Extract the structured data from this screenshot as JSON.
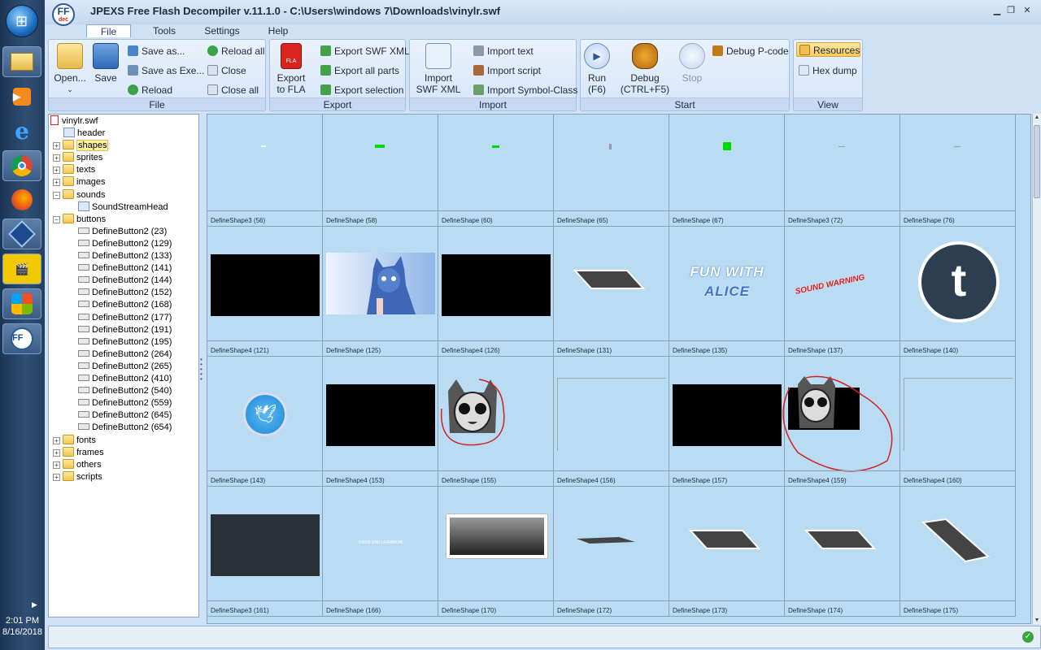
{
  "taskbar": {
    "icons": [
      "windows-start-icon",
      "file-explorer-icon",
      "media-player-icon",
      "internet-explorer-icon",
      "chrome-icon",
      "firefox-icon",
      "virtualbox-icon",
      "video-editor-icon",
      "windows-media-icon",
      "jpexs-ffdec-icon"
    ],
    "time": "2:01 PM",
    "date": "8/16/2018"
  },
  "window": {
    "title": "JPEXS Free Flash Decompiler v.11.1.0 - C:\\Users\\windows 7\\Downloads\\vinylr.swf",
    "logo_text": "FF",
    "logo_sub": "dec"
  },
  "ribbon": {
    "tabs": [
      "File",
      "Tools",
      "Settings",
      "Help"
    ],
    "active_tab": "File",
    "groups": {
      "file": {
        "label": "File",
        "open": "Open...",
        "save": "Save",
        "save_as": "Save as...",
        "save_as_exe": "Save as Exe...",
        "reload": "Reload",
        "reload_all": "Reload all",
        "close": "Close",
        "close_all": "Close all"
      },
      "export": {
        "label": "Export",
        "export_fla_1": "Export",
        "export_fla_2": "to FLA",
        "export_swf_xml": "Export SWF XML",
        "export_all_parts": "Export all parts",
        "export_selection": "Export selection"
      },
      "import": {
        "label": "Import",
        "import_swf_xml_1": "Import",
        "import_swf_xml_2": "SWF XML",
        "import_text": "Import text",
        "import_script": "Import script",
        "import_symbol_class": "Import Symbol-Class"
      },
      "start": {
        "label": "Start",
        "run_1": "Run",
        "run_2": "(F6)",
        "debug_1": "Debug",
        "debug_2": "(CTRL+F5)",
        "stop": "Stop",
        "debug_pcode": "Debug P-code"
      },
      "view": {
        "label": "View",
        "resources": "Resources",
        "hex_dump": "Hex dump"
      }
    }
  },
  "tree": {
    "root": "vinylr.swf",
    "nodes": [
      {
        "label": "header",
        "type": "file",
        "level": 1,
        "expander": ""
      },
      {
        "label": "shapes",
        "type": "folder",
        "level": 1,
        "expander": "+",
        "selected": true
      },
      {
        "label": "sprites",
        "type": "folder",
        "level": 1,
        "expander": "+"
      },
      {
        "label": "texts",
        "type": "folder",
        "level": 1,
        "expander": "+"
      },
      {
        "label": "images",
        "type": "folder",
        "level": 1,
        "expander": "+"
      },
      {
        "label": "sounds",
        "type": "folder",
        "level": 1,
        "expander": "−"
      },
      {
        "label": "SoundStreamHead",
        "type": "sound",
        "level": 2,
        "expander": ""
      },
      {
        "label": "buttons",
        "type": "folder",
        "level": 1,
        "expander": "−"
      },
      {
        "label": "DefineButton2 (23)",
        "type": "button",
        "level": 2,
        "expander": ""
      },
      {
        "label": "DefineButton2 (129)",
        "type": "button",
        "level": 2,
        "expander": ""
      },
      {
        "label": "DefineButton2 (133)",
        "type": "button",
        "level": 2,
        "expander": ""
      },
      {
        "label": "DefineButton2 (141)",
        "type": "button",
        "level": 2,
        "expander": ""
      },
      {
        "label": "DefineButton2 (144)",
        "type": "button",
        "level": 2,
        "expander": ""
      },
      {
        "label": "DefineButton2 (152)",
        "type": "button",
        "level": 2,
        "expander": ""
      },
      {
        "label": "DefineButton2 (168)",
        "type": "button",
        "level": 2,
        "expander": ""
      },
      {
        "label": "DefineButton2 (177)",
        "type": "button",
        "level": 2,
        "expander": ""
      },
      {
        "label": "DefineButton2 (191)",
        "type": "button",
        "level": 2,
        "expander": ""
      },
      {
        "label": "DefineButton2 (195)",
        "type": "button",
        "level": 2,
        "expander": ""
      },
      {
        "label": "DefineButton2 (264)",
        "type": "button",
        "level": 2,
        "expander": ""
      },
      {
        "label": "DefineButton2 (265)",
        "type": "button",
        "level": 2,
        "expander": ""
      },
      {
        "label": "DefineButton2 (410)",
        "type": "button",
        "level": 2,
        "expander": ""
      },
      {
        "label": "DefineButton2 (540)",
        "type": "button",
        "level": 2,
        "expander": ""
      },
      {
        "label": "DefineButton2 (559)",
        "type": "button",
        "level": 2,
        "expander": ""
      },
      {
        "label": "DefineButton2 (645)",
        "type": "button",
        "level": 2,
        "expander": ""
      },
      {
        "label": "DefineButton2 (654)",
        "type": "button",
        "level": 2,
        "expander": ""
      },
      {
        "label": "fonts",
        "type": "folder",
        "level": 1,
        "expander": "+"
      },
      {
        "label": "frames",
        "type": "folder",
        "level": 1,
        "expander": "+"
      },
      {
        "label": "others",
        "type": "folder",
        "level": 1,
        "expander": "+"
      },
      {
        "label": "scripts",
        "type": "folder",
        "level": 1,
        "expander": "+"
      }
    ]
  },
  "gallery": {
    "rows": [
      [
        {
          "caption": "DefineShape3 (56)",
          "thumb": "tiny-white"
        },
        {
          "caption": "DefineShape (58)",
          "thumb": "green-bar"
        },
        {
          "caption": "DefineShape (60)",
          "thumb": "green-bar-small"
        },
        {
          "caption": "DefineShape (65)",
          "thumb": "tiny-gray"
        },
        {
          "caption": "DefineShape (67)",
          "thumb": "green-square"
        },
        {
          "caption": "DefineShape3 (72)",
          "thumb": "tiny-line"
        },
        {
          "caption": "DefineShape (76)",
          "thumb": "tiny-line"
        }
      ],
      [
        {
          "caption": "DefineShape4 (121)",
          "thumb": "black-rect"
        },
        {
          "caption": "DefineShape (125)",
          "thumb": "character-art"
        },
        {
          "caption": "DefineShape4 (126)",
          "thumb": "black-rect"
        },
        {
          "caption": "DefineShape (131)",
          "thumb": "parallelogram"
        },
        {
          "caption": "DefineShape (135)",
          "thumb": "fun-with-alice"
        },
        {
          "caption": "DefineShape (137)",
          "thumb": "sound-warning"
        },
        {
          "caption": "DefineShape (140)",
          "thumb": "tumblr-logo"
        }
      ],
      [
        {
          "caption": "DefineShape (143)",
          "thumb": "twitter-logo"
        },
        {
          "caption": "DefineShape4 (153)",
          "thumb": "black-rect"
        },
        {
          "caption": "DefineShape (155)",
          "thumb": "cat-face-circled"
        },
        {
          "caption": "DefineShape4 (156)",
          "thumb": "empty-frame"
        },
        {
          "caption": "DefineShape (157)",
          "thumb": "black-rect"
        },
        {
          "caption": "DefineShape4 (159)",
          "thumb": "cat-face-box-circled"
        },
        {
          "caption": "DefineShape4 (160)",
          "thumb": "empty-frame"
        }
      ],
      [
        {
          "caption": "DefineShape3 (161)",
          "thumb": "dark-rect"
        },
        {
          "caption": "DefineShape (166)",
          "thumb": "small-text"
        },
        {
          "caption": "DefineShape (170)",
          "thumb": "framed-gradient"
        },
        {
          "caption": "DefineShape (172)",
          "thumb": "thin-parallelogram"
        },
        {
          "caption": "DefineShape (173)",
          "thumb": "parallelogram"
        },
        {
          "caption": "DefineShape (174)",
          "thumb": "parallelogram"
        },
        {
          "caption": "DefineShape (175)",
          "thumb": "tilted-parallelogram"
        }
      ]
    ],
    "thumb_texts": {
      "fun": "FUN WITH",
      "alice": "ALICE",
      "warning": "SOUND WARNING",
      "small": "©2008 VINYLRAINBOW"
    }
  },
  "colors": {
    "gallery_bg": "#b9dcf3",
    "annotation_red": "#d42020",
    "accent": "#2a5a9a"
  }
}
